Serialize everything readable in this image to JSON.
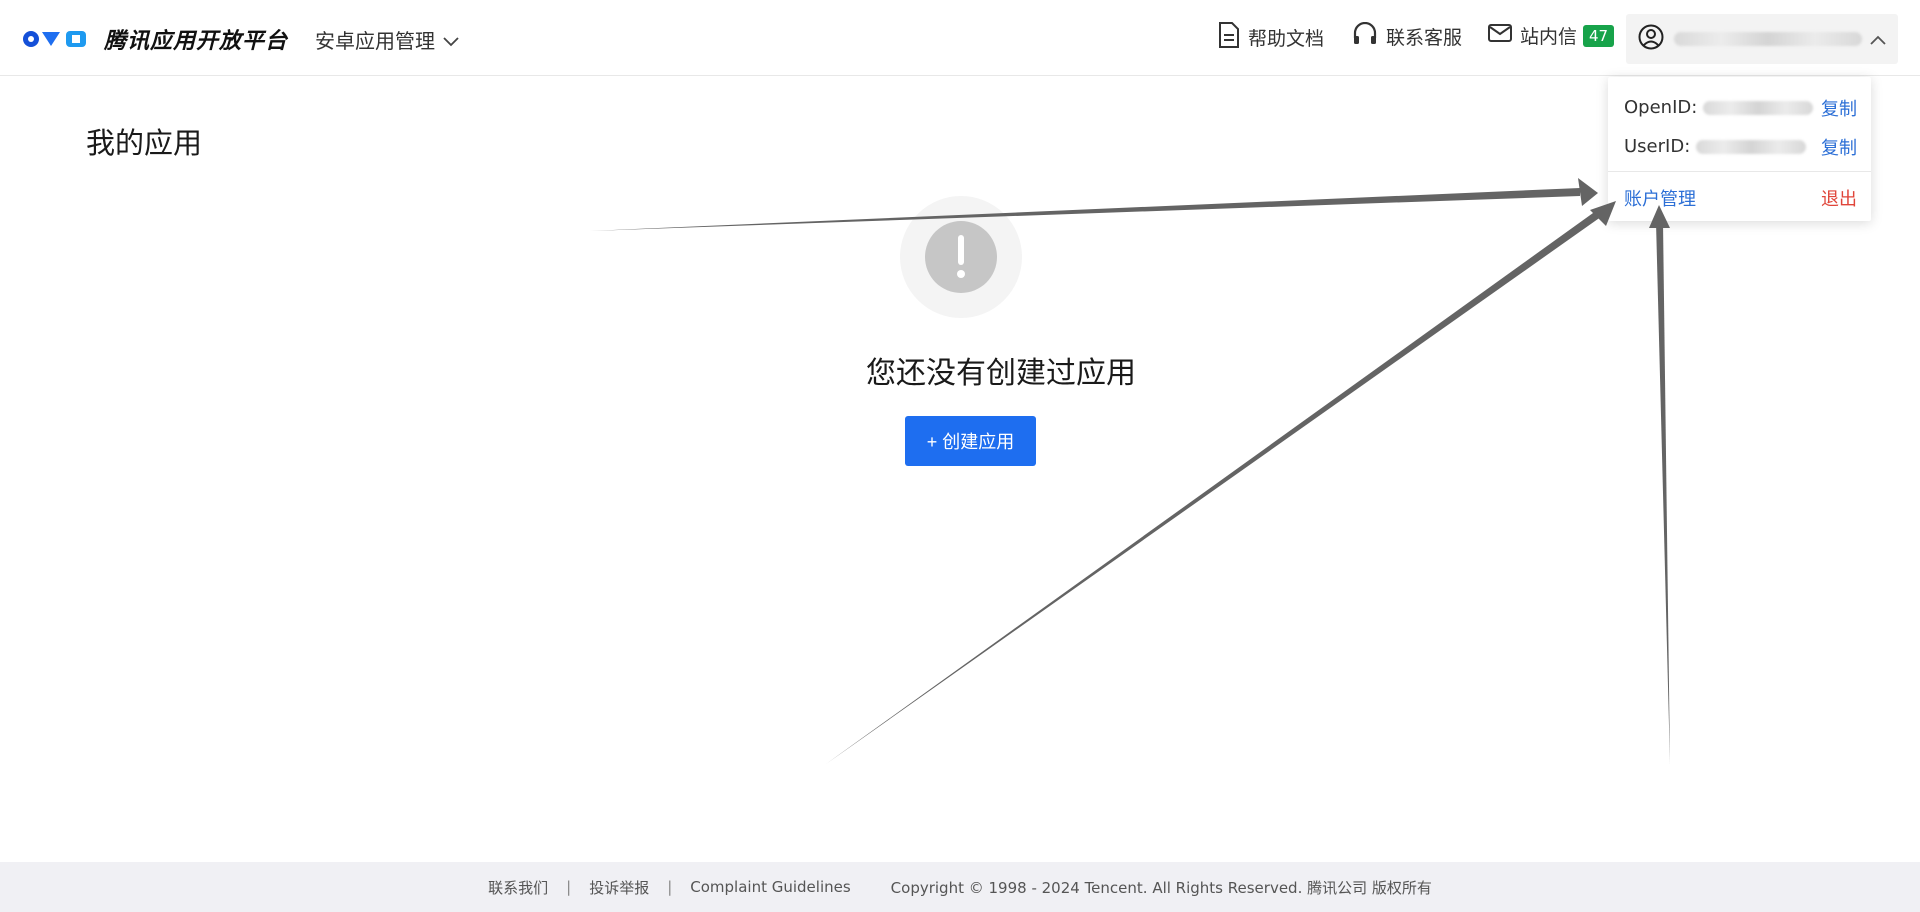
{
  "header": {
    "brand_name": "腾讯应用开放平台",
    "app_switch_label": "安卓应用管理",
    "help_docs": "帮助文档",
    "contact_support": "联系客服",
    "inbox_label": "站内信",
    "inbox_count": "47"
  },
  "user_menu": {
    "openid_label": "OpenID:",
    "userid_label": "UserID:",
    "copy_label": "复制",
    "account_manage": "账户管理",
    "logout": "退出"
  },
  "main": {
    "title": "我的应用",
    "empty_text": "您还没有创建过应用",
    "create_button": "+ 创建应用"
  },
  "footer": {
    "contact_us": "联系我们",
    "report": "投诉举报",
    "guidelines": "Complaint Guidelines",
    "separator": "|",
    "copyright": "Copyright © 1998 - 2024 Tencent. All Rights Reserved. 腾讯公司 版权所有"
  },
  "colors": {
    "primary": "#1e6ef0",
    "link": "#2c6fd6",
    "danger": "#e0453a",
    "badge": "#17a34a"
  }
}
